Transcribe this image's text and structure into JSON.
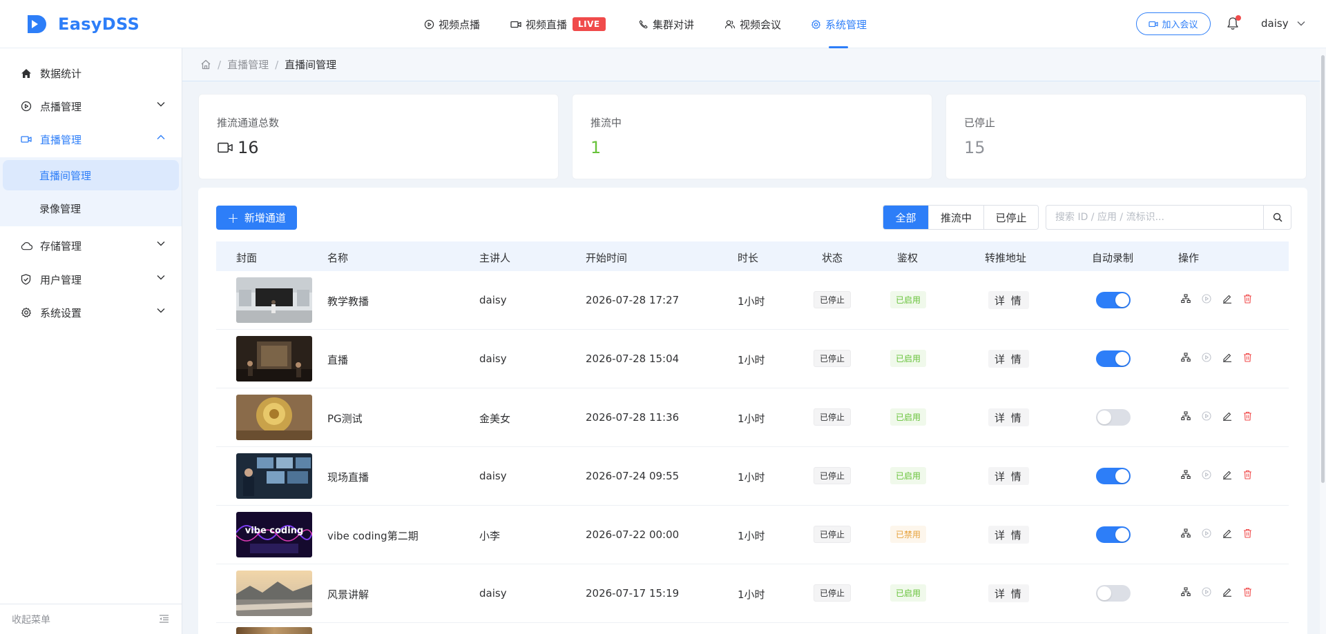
{
  "app": {
    "name": "EasyDSS"
  },
  "colors": {
    "accent": "#2d7ef8",
    "live": "#f04b4b",
    "success": "#67c23a",
    "warning": "#e6a23c"
  },
  "topnav": {
    "items": [
      {
        "label": "视频点播",
        "icon": "play-circle-icon",
        "active": false
      },
      {
        "label": "视频直播",
        "icon": "video-camera-icon",
        "active": false,
        "badge": "LIVE"
      },
      {
        "label": "集群对讲",
        "icon": "phone-icon",
        "active": false
      },
      {
        "label": "视频会议",
        "icon": "users-icon",
        "active": false
      },
      {
        "label": "系统管理",
        "icon": "gear-icon",
        "active": true
      }
    ],
    "join_meeting": "加入会议",
    "user": "daisy"
  },
  "sidebar": {
    "items": [
      {
        "label": "数据统计",
        "icon": "home-icon"
      },
      {
        "label": "点播管理",
        "icon": "play-circle-icon"
      },
      {
        "label": "直播管理",
        "icon": "video-camera-icon",
        "open": true
      },
      {
        "label": "存储管理",
        "icon": "cloud-icon"
      },
      {
        "label": "用户管理",
        "icon": "shield-icon"
      },
      {
        "label": "系统设置",
        "icon": "gear-icon"
      }
    ],
    "submenu": [
      {
        "label": "直播间管理",
        "active": true
      },
      {
        "label": "录像管理",
        "active": false
      }
    ],
    "collapse_label": "收起菜单"
  },
  "breadcrumb": {
    "items": [
      "直播管理",
      "直播间管理"
    ]
  },
  "stats": [
    {
      "label": "推流通道总数",
      "value": "16"
    },
    {
      "label": "推流中",
      "value": "1"
    },
    {
      "label": "已停止",
      "value": "15"
    }
  ],
  "toolbar": {
    "add_label": "新增通道",
    "filters": [
      "全部",
      "推流中",
      "已停止"
    ],
    "active_filter": "全部",
    "search_placeholder": "搜索 ID / 应用 / 流标识...",
    "search_value": ""
  },
  "table": {
    "columns": [
      "封面",
      "名称",
      "主讲人",
      "开始时间",
      "时长",
      "状态",
      "鉴权",
      "转推地址",
      "自动录制",
      "操作"
    ],
    "rows": [
      {
        "name": "教学教播",
        "host": "daisy",
        "start": "2026-07-28 17:27",
        "duration": "1小时",
        "status": "已停止",
        "auth": "已启用",
        "auth_state": "on",
        "relay": "详 情",
        "auto_record": true,
        "thumb": "classroom"
      },
      {
        "name": "直播",
        "host": "daisy",
        "start": "2026-07-28 15:04",
        "duration": "1小时",
        "status": "已停止",
        "auth": "已启用",
        "auth_state": "on",
        "relay": "详 情",
        "auto_record": true,
        "thumb": "temple"
      },
      {
        "name": "PG测试",
        "host": "金美女",
        "start": "2026-07-28 11:36",
        "duration": "1小时",
        "status": "已停止",
        "auth": "已启用",
        "auth_state": "on",
        "relay": "详 情",
        "auto_record": false,
        "thumb": "gold"
      },
      {
        "name": "现场直播",
        "host": "daisy",
        "start": "2026-07-24 09:55",
        "duration": "1小时",
        "status": "已停止",
        "auth": "已启用",
        "auth_state": "on",
        "relay": "详 情",
        "auto_record": true,
        "thumb": "control"
      },
      {
        "name": "vibe coding第二期",
        "host": "小李",
        "start": "2026-07-22 00:00",
        "duration": "1小时",
        "status": "已停止",
        "auth": "已禁用",
        "auth_state": "off",
        "relay": "详 情",
        "auto_record": true,
        "thumb": "vibe",
        "thumb_text": "vibe coding"
      },
      {
        "name": "风景讲解",
        "host": "daisy",
        "start": "2026-07-17 15:19",
        "duration": "1小时",
        "status": "已停止",
        "auth": "已启用",
        "auth_state": "on",
        "relay": "详 情",
        "auto_record": false,
        "thumb": "landscape"
      }
    ]
  }
}
